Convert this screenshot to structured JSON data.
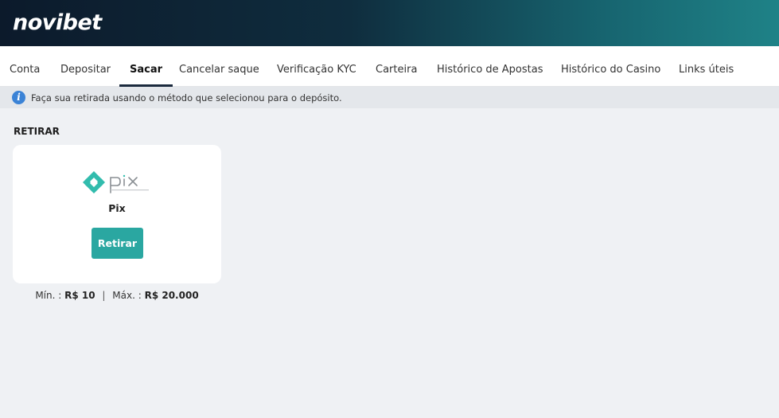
{
  "brand": {
    "logo_text": "novibet"
  },
  "tabs": [
    {
      "label": "Conta",
      "active": false
    },
    {
      "label": "Depositar",
      "active": false
    },
    {
      "label": "Sacar",
      "active": true
    },
    {
      "label": "Cancelar saque",
      "active": false
    },
    {
      "label": "Verificação KYC",
      "active": false
    },
    {
      "label": "Carteira",
      "active": false
    },
    {
      "label": "Histórico de Apostas",
      "active": false
    },
    {
      "label": "Histórico do Casino",
      "active": false
    },
    {
      "label": "Links úteis",
      "active": false
    }
  ],
  "info": {
    "icon": "info-icon",
    "text": "Faça sua retirada usando o método que selecionou para o depósito."
  },
  "withdraw": {
    "section_title": "RETIRAR",
    "method": {
      "name": "Pix",
      "logo_icon": "pix-logo-icon",
      "button_label": "Retirar",
      "min_label": "Mín. :",
      "min_value": "R$ 10",
      "separator": "|",
      "max_label": "Máx. :",
      "max_value": "R$ 20.000"
    }
  },
  "colors": {
    "header_dark": "#0c1a2b",
    "header_teal": "#1f8287",
    "accent": "#2aa7a1",
    "pix_teal": "#32bcad",
    "info_blue": "#3b83d6"
  }
}
